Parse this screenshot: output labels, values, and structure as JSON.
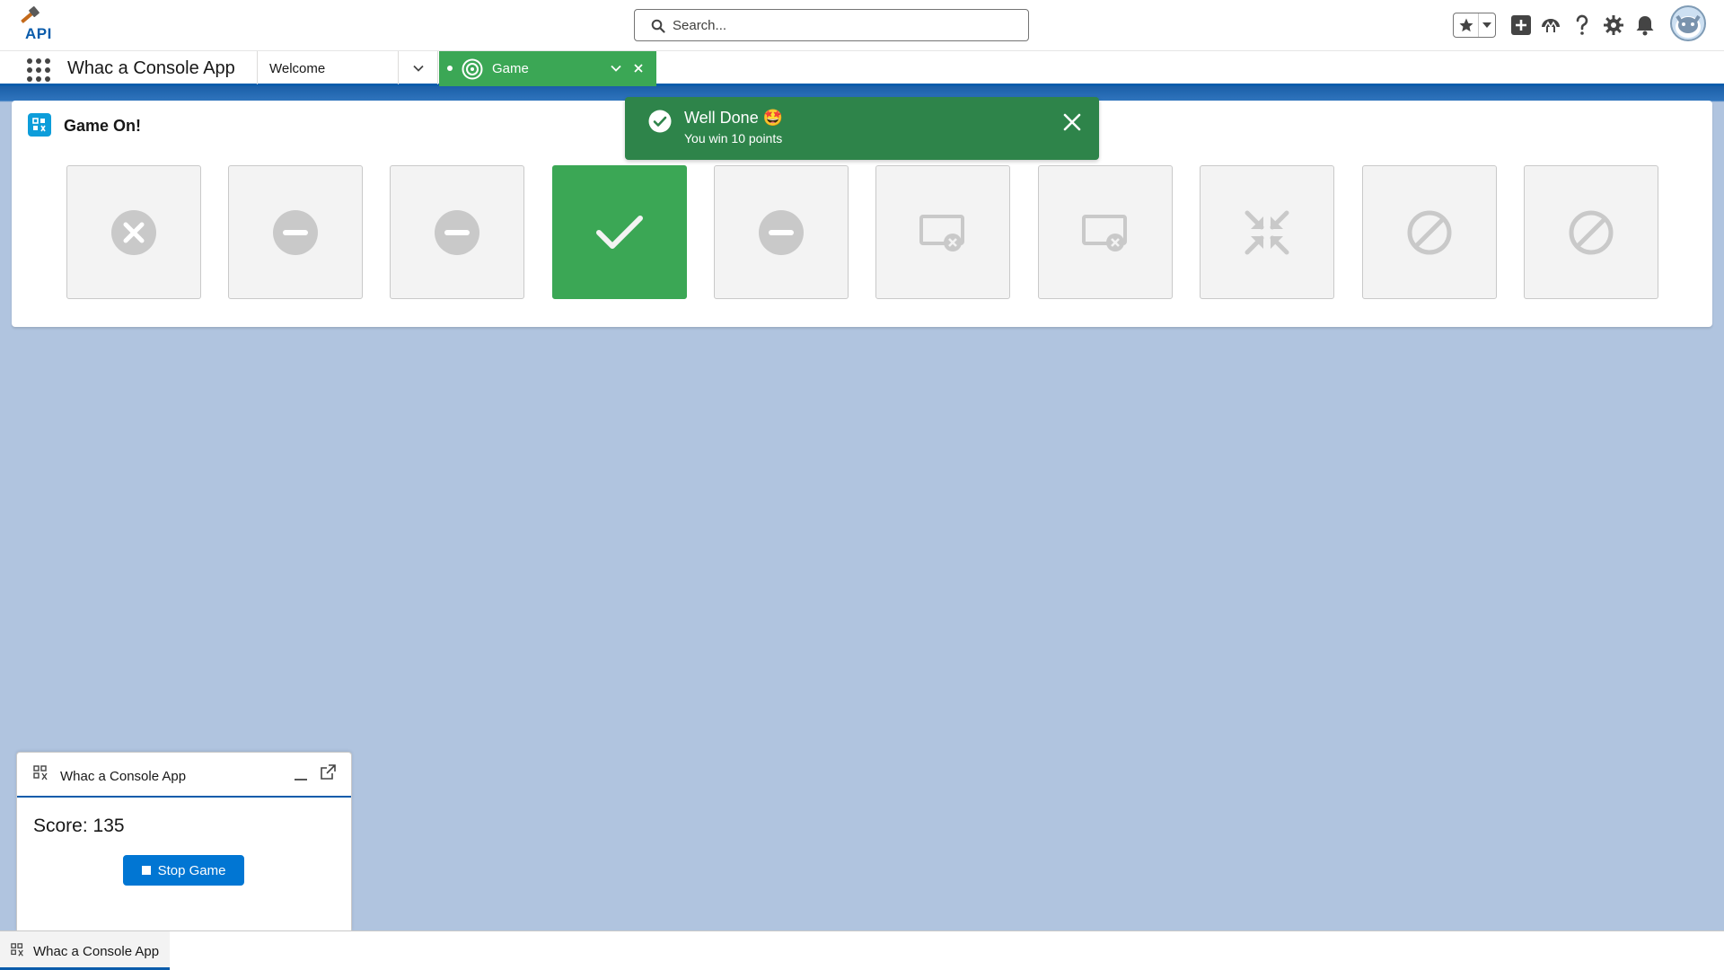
{
  "header": {
    "logo_text": "API",
    "search_placeholder": "Search...",
    "icons": [
      "favorites-star-icon",
      "favorites-dropdown-icon",
      "global-add-icon",
      "trailhead-icon",
      "help-icon",
      "setup-gear-icon",
      "notifications-bell-icon",
      "user-avatar"
    ]
  },
  "nav": {
    "app_name": "Whac a Console App",
    "tabs": [
      {
        "label": "Welcome"
      },
      {
        "label": "Game",
        "active": true
      }
    ]
  },
  "card": {
    "title": "Game On!",
    "tiles": [
      {
        "icon": "x-circle-icon",
        "state": "idle"
      },
      {
        "icon": "minus-circle-icon",
        "state": "idle"
      },
      {
        "icon": "minus-circle-icon",
        "state": "idle"
      },
      {
        "icon": "check-icon",
        "state": "hit"
      },
      {
        "icon": "minus-circle-icon",
        "state": "idle"
      },
      {
        "icon": "screen-x-icon",
        "state": "idle"
      },
      {
        "icon": "screen-x-icon",
        "state": "idle"
      },
      {
        "icon": "contract-arrows-icon",
        "state": "idle"
      },
      {
        "icon": "ban-icon",
        "state": "idle"
      },
      {
        "icon": "ban-icon",
        "state": "idle"
      }
    ]
  },
  "toast": {
    "title": "Well Done 🤩",
    "message": "You win 10 points"
  },
  "utility_panel": {
    "title": "Whac a Console App",
    "score": "Score: 135",
    "stop_button": "Stop Game"
  },
  "utility_bar": {
    "item_label": "Whac a Console App"
  },
  "colors": {
    "brand_blue": "#0b5cab",
    "success_green": "#3ba755",
    "toast_green": "#2e844a",
    "button_blue": "#0176d3",
    "background": "#b0c4df"
  }
}
